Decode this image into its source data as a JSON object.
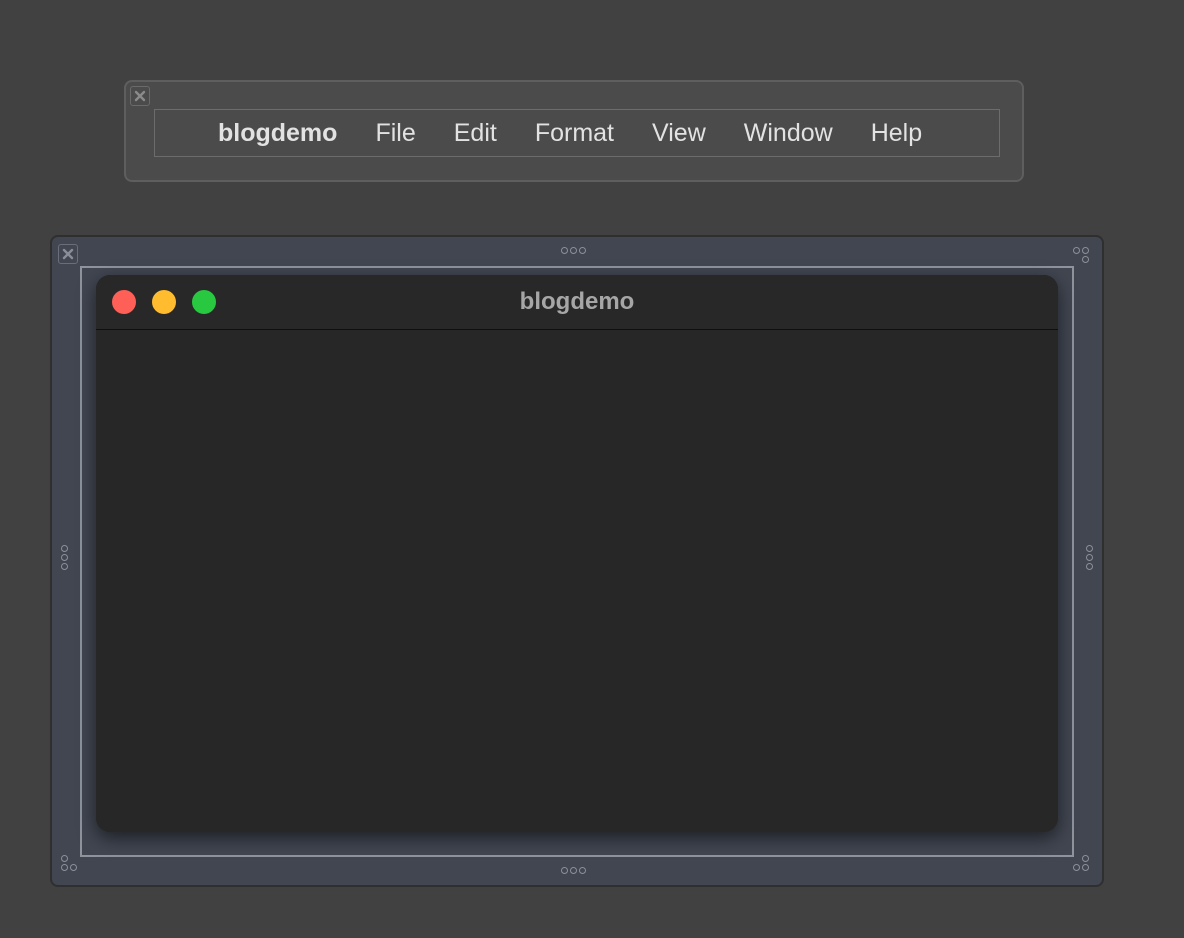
{
  "menu_bar": {
    "app_name": "blogdemo",
    "items": [
      {
        "label": "File"
      },
      {
        "label": "Edit"
      },
      {
        "label": "Format"
      },
      {
        "label": "View"
      },
      {
        "label": "Window"
      },
      {
        "label": "Help"
      }
    ]
  },
  "window": {
    "title": "blogdemo",
    "controls": {
      "close_color": "#fe5f57",
      "minimize_color": "#febc2e",
      "zoom_color": "#28c840"
    }
  },
  "icons": {
    "panel_close": "close-icon",
    "resize_handle": "resize-handle-icon"
  }
}
